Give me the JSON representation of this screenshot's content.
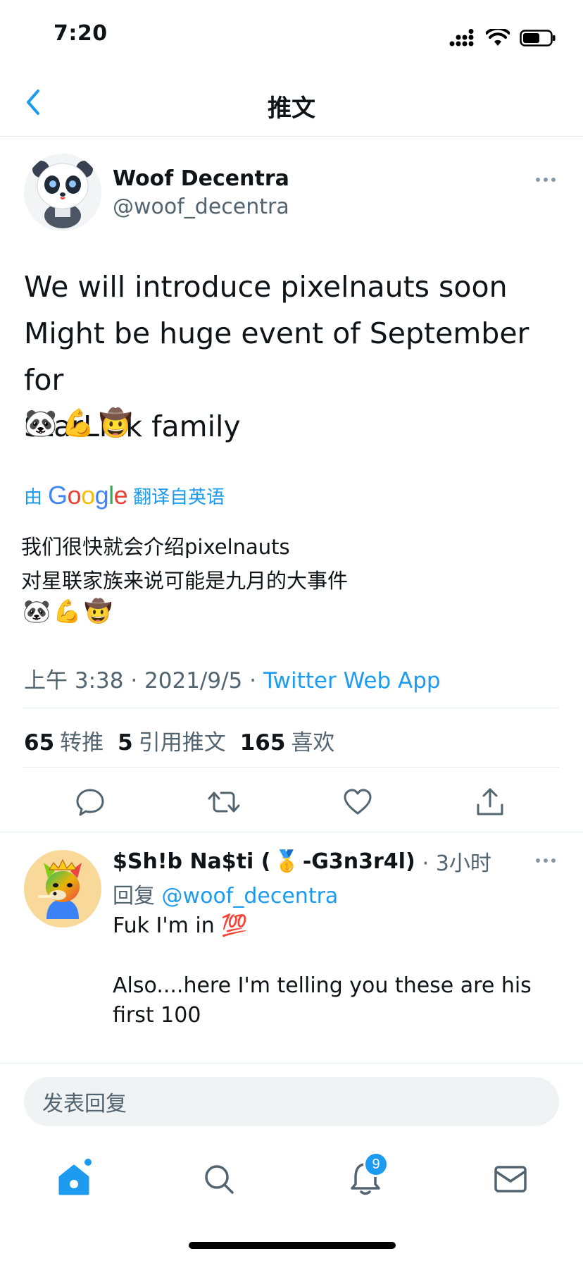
{
  "status_bar": {
    "time": "7:20"
  },
  "nav": {
    "title": "推文",
    "back_icon": "chevron-left-icon"
  },
  "tweet": {
    "author_name": "Woof Decentra",
    "author_handle": "@woof_decentra",
    "text_lines": [
      "We will introduce pixelnauts soon",
      "Might be huge event of September for",
      "StarLink family"
    ],
    "emojis": [
      "🐼",
      "💪",
      "🤠"
    ],
    "translation": {
      "prefix": "由",
      "google": "Google",
      "suffix": "翻译自英语",
      "lines": [
        "我们很快就会介绍pixelnauts",
        "对星联家族来说可能是九月的大事件"
      ]
    },
    "time": "上午 3:38",
    "date": "2021/9/5",
    "source": "Twitter Web App",
    "separator": " · ",
    "stats": {
      "retweets": "65",
      "retweets_label": "转推",
      "quotes": "5",
      "quotes_label": "引用推文",
      "likes": "165",
      "likes_label": "喜欢"
    }
  },
  "reply": {
    "name_start": "$Sh!b Na$ti (",
    "medal": "🥇",
    "name_end": "-G3n3r4l)",
    "time": "· 3小时",
    "reply_prefix": "回复",
    "reply_to": "@woof_decentra",
    "text_1": "Fuk I'm in",
    "text_1_emoji": "💯",
    "text_2": "Also....here I'm telling you these are his first 100"
  },
  "compose": {
    "placeholder": "发表回复"
  },
  "tab_bar": {
    "notification_count": "9"
  },
  "colors": {
    "accent": "#1d9bf0",
    "secondary_text": "#536471",
    "divider": "#e6ecf0"
  }
}
